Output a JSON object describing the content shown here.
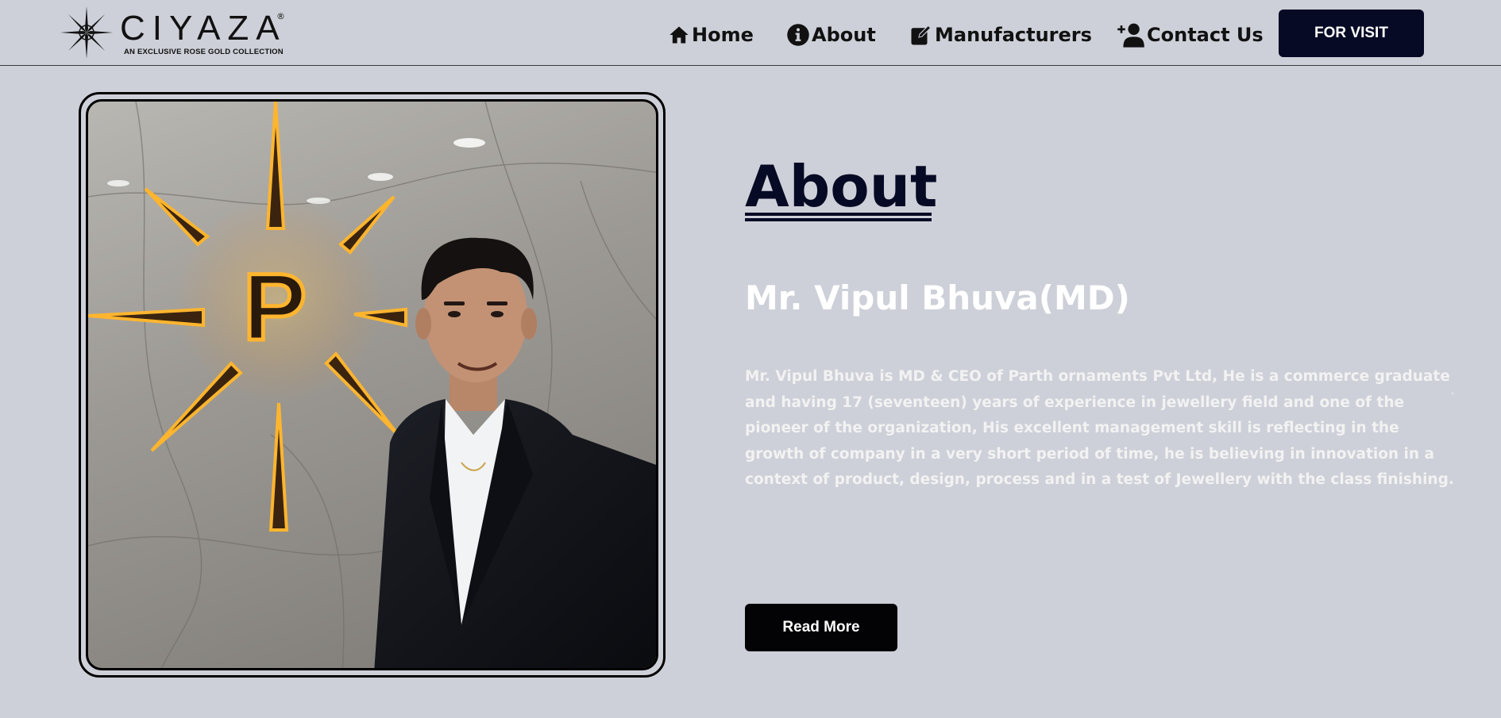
{
  "header": {
    "logo": {
      "wordmark": "CIYAZA",
      "registered_mark": "®",
      "tagline": "AN EXCLUSIVE ROSE GOLD COLLECTION"
    },
    "nav": [
      {
        "label": "Home",
        "icon": "home-icon"
      },
      {
        "label": "About",
        "icon": "info-icon"
      },
      {
        "label": "Manufacturers",
        "icon": "edit-icon"
      },
      {
        "label": "Contact Us",
        "icon": "user-plus-icon"
      }
    ],
    "cta_label": "FOR VISIT"
  },
  "about": {
    "heading": "About",
    "name": "Mr. Vipul Bhuva(MD)",
    "bio": "Mr. Vipul Bhuva is MD & CEO of Parth ornaments Pvt Ltd, He is a commerce graduate and having 17 (seventeen) years of experience in jewellery field and one of the pioneer of the organization, His excellent management skill is reflecting in the growth of company in a very short period of time, he is believing in innovation in a context of product, design, process and in a test of Jewellery with the class finishing.",
    "stray_mark": "`",
    "read_more_label": "Read More",
    "photo": {
      "sign_letter": "P"
    }
  },
  "colors": {
    "page_bg": "#cdd0d8",
    "navy": "#060a24",
    "button_black": "#030305",
    "text_white": "#ffffff"
  }
}
